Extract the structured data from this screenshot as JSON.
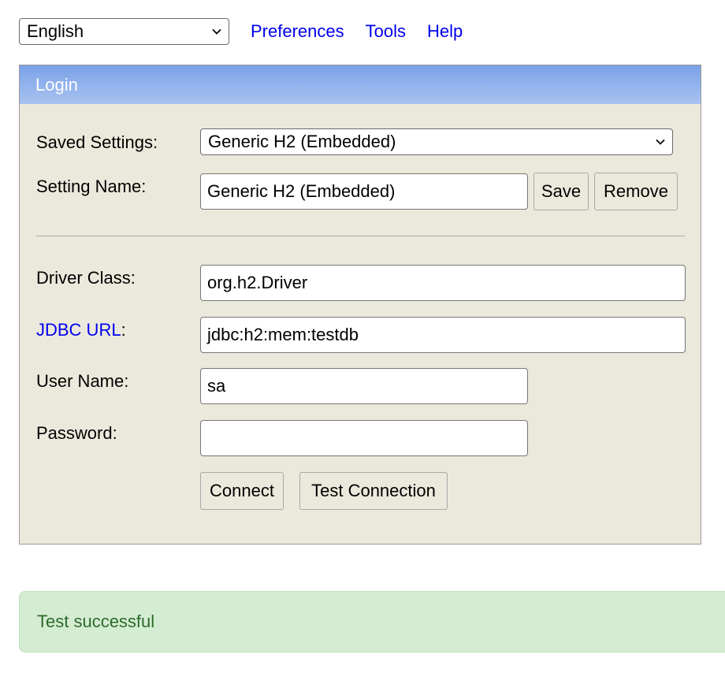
{
  "top": {
    "language": "English",
    "links": [
      "Preferences",
      "Tools",
      "Help"
    ]
  },
  "panel": {
    "title": "Login",
    "saved_settings_label": "Saved Settings:",
    "saved_settings_value": "Generic H2 (Embedded)",
    "setting_name_label": "Setting Name:",
    "setting_name_value": "Generic H2 (Embedded)",
    "save_label": "Save",
    "remove_label": "Remove",
    "driver_class_label": "Driver Class:",
    "driver_class_value": "org.h2.Driver",
    "jdbc_url_label": "JDBC URL",
    "jdbc_url_suffix": ":",
    "jdbc_url_value": "jdbc:h2:mem:testdb",
    "user_name_label": "User Name:",
    "user_name_value": "sa",
    "password_label": "Password:",
    "password_value": "",
    "connect_label": "Connect",
    "test_connection_label": "Test Connection"
  },
  "status": {
    "message": "Test successful",
    "color": "#2d6a2b",
    "background": "#d4edd2"
  },
  "colors": {
    "header_start": "#7aa2e8",
    "header_end": "#a8c2f0",
    "panel_bg": "#ebe9dc",
    "link": "#0000ee"
  }
}
